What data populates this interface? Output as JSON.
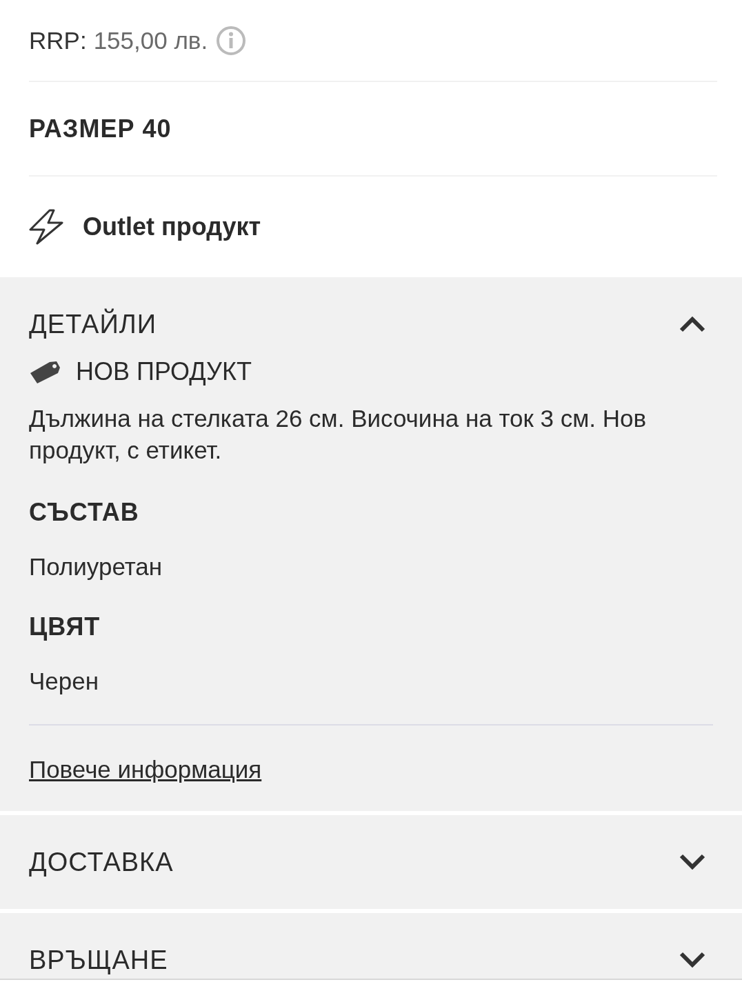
{
  "price": {
    "label": "RRP:",
    "value": "155,00 лв."
  },
  "size": "РАЗМЕР 40",
  "badge": "Outlet продукт",
  "sections": [
    {
      "title": "ДЕТАЙЛИ",
      "expanded": true,
      "tag": "НОВ ПРОДУКТ",
      "description": "Дължина на стелката 26 см. Височина на ток 3 см. Нов продукт, с етикет.",
      "attributes": [
        {
          "label": "СЪСТАВ",
          "value": "Полиуретан"
        },
        {
          "label": "ЦВЯТ",
          "value": "Черен"
        }
      ],
      "link": "Повече информация"
    },
    {
      "title": "ДОСТАВКА",
      "expanded": false
    },
    {
      "title": "ВРЪЩАНЕ",
      "expanded": false
    }
  ]
}
